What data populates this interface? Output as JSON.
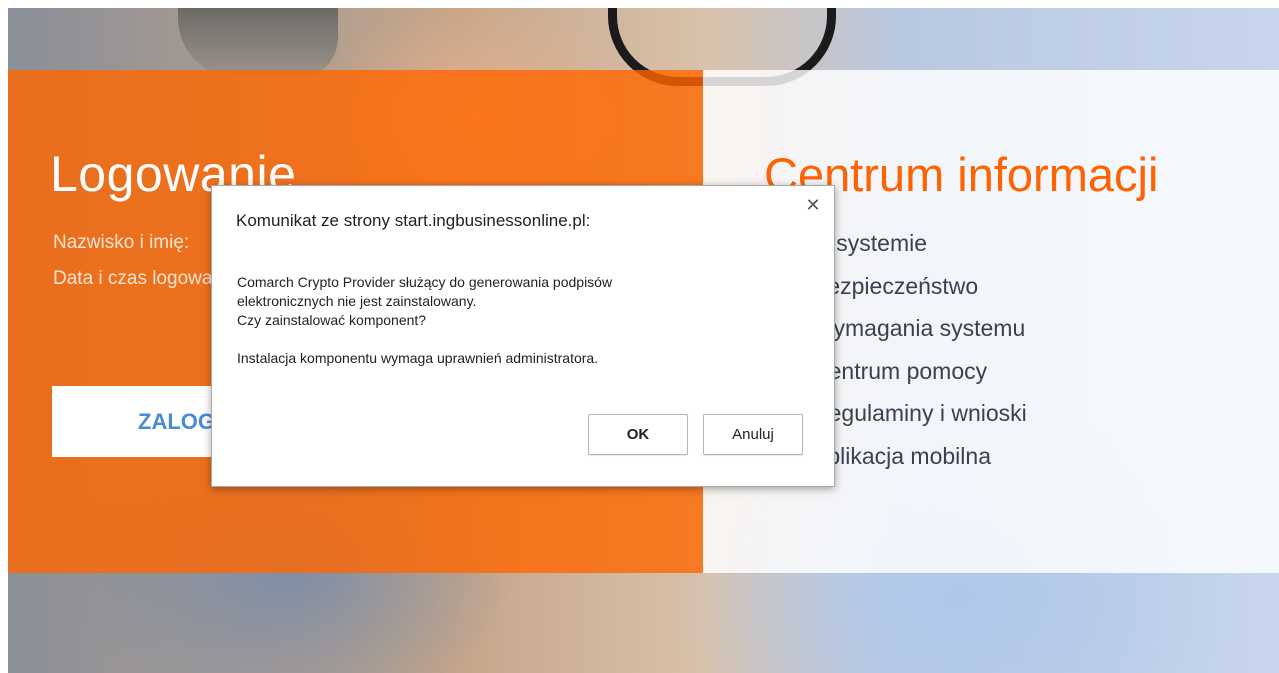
{
  "login": {
    "title": "Logowanie",
    "line1": "Nazwisko i imię:",
    "line2": "Data i czas logowania:",
    "button": "ZALOGUJ"
  },
  "info": {
    "title": "Centrum informacji",
    "items": [
      "O systemie",
      "Bezpieczeństwo",
      "Wymagania systemu",
      "Centrum pomocy",
      "Regulaminy i wnioski",
      "Aplikacja mobilna"
    ]
  },
  "dialog": {
    "title": "Komunikat ze strony start.ingbusinessonline.pl:",
    "line1": "Comarch Crypto Provider służący do generowania podpisów",
    "line2": "elektronicznych nie jest zainstalowany.",
    "line3": "Czy zainstalować komponent?",
    "note": "Instalacja komponentu wymaga uprawnień administratora.",
    "ok_label": "OK",
    "cancel_label": "Anuluj",
    "close_icon": "close-icon"
  },
  "colors": {
    "accent": "#ff6200",
    "link_blue": "#4a8cd4"
  }
}
